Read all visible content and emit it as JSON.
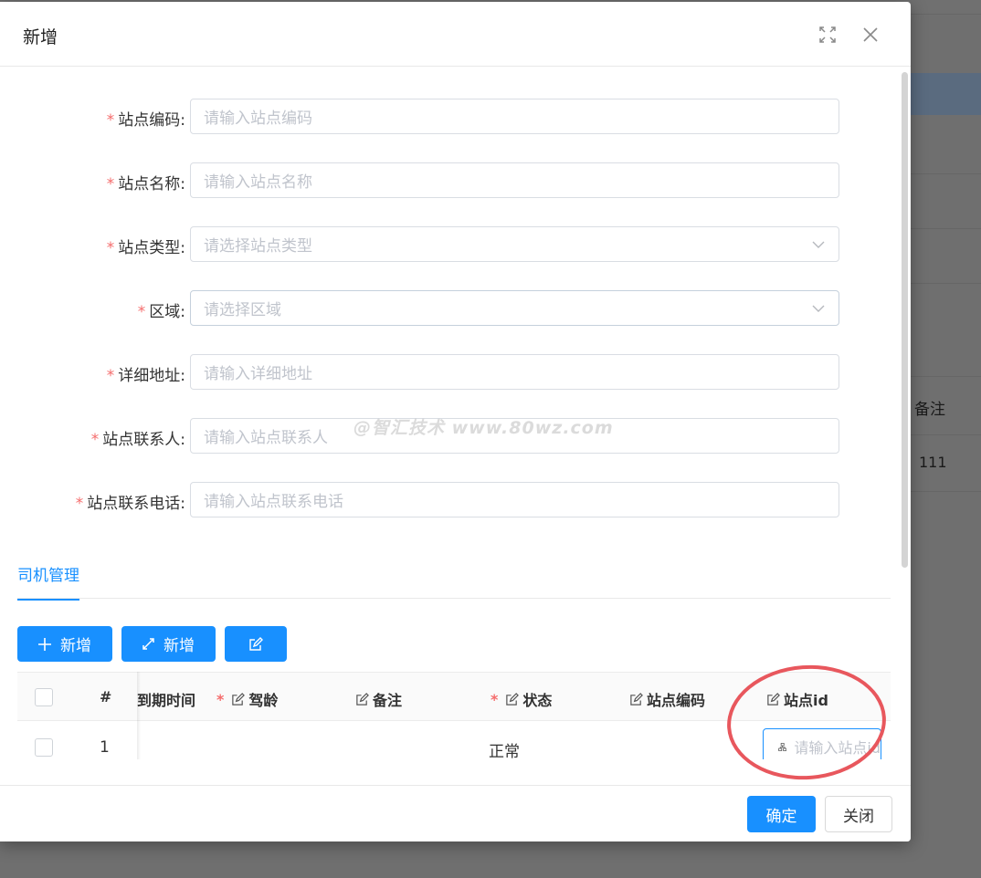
{
  "modal": {
    "title": "新增"
  },
  "form": {
    "fields": [
      {
        "label": "站点编码:",
        "placeholder": "请输入站点编码",
        "type": "input"
      },
      {
        "label": "站点名称:",
        "placeholder": "请输入站点名称",
        "type": "input"
      },
      {
        "label": "站点类型:",
        "placeholder": "请选择站点类型",
        "type": "select"
      },
      {
        "label": "区域:",
        "placeholder": "请选择区域",
        "type": "select"
      },
      {
        "label": "详细地址:",
        "placeholder": "请输入详细地址",
        "type": "input"
      },
      {
        "label": "站点联系人:",
        "placeholder": "请输入站点联系人",
        "type": "input"
      },
      {
        "label": "站点联系电话:",
        "placeholder": "请输入站点联系电话",
        "type": "input"
      }
    ],
    "required_mark": "*"
  },
  "watermark": "@智汇技术 www.80wz.com",
  "tabs": {
    "active": "司机管理"
  },
  "toolbar": {
    "add_label": "新增",
    "add_fullscreen_label": "新增"
  },
  "table": {
    "headers": {
      "index": "#",
      "expire_time": "到期时间",
      "driving_age": "驾龄",
      "remark": "备注",
      "status": "状态",
      "site_code": "站点编码",
      "site_id": "站点id"
    },
    "rows": [
      {
        "index": "1",
        "status": "正常",
        "site_id_placeholder": "请输入站点id"
      }
    ]
  },
  "footer": {
    "ok_label": "确定",
    "close_label": "关闭"
  },
  "background": {
    "column_header": "备注",
    "cell_value": "111"
  },
  "colors": {
    "primary": "#1890ff",
    "required": "#f56c6c",
    "annotation_circle": "#e8575d"
  }
}
